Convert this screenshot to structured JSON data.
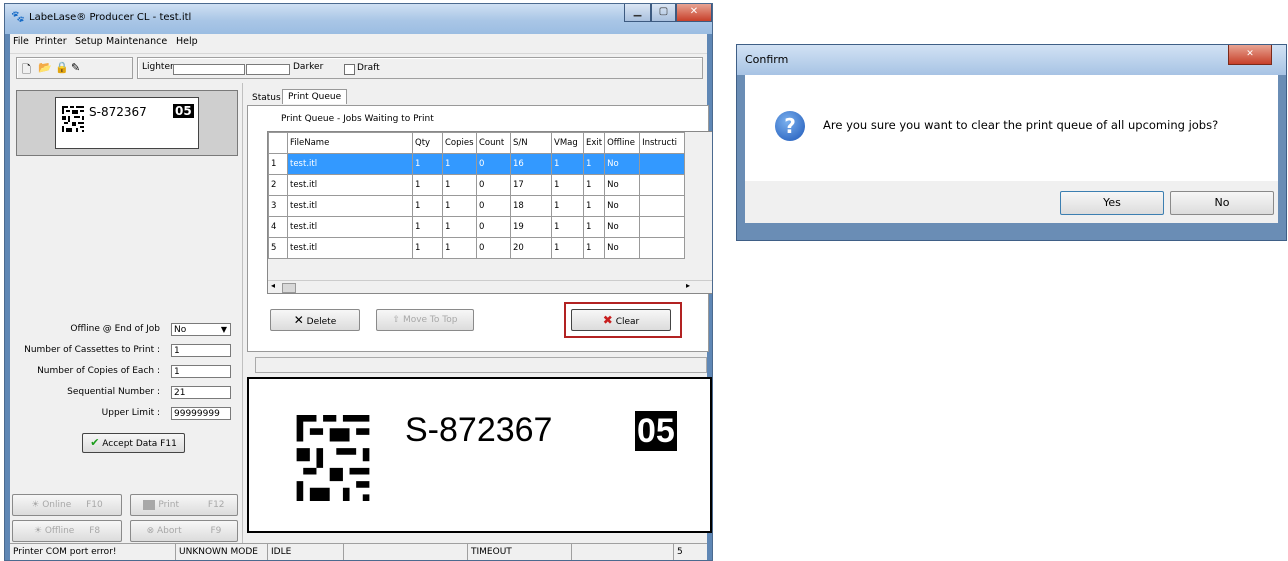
{
  "main_window": {
    "title": "LabeLase® Producer CL - test.itl",
    "menu": [
      "File",
      "Printer",
      "Setup",
      "Maintenance",
      "Help"
    ],
    "toolbar": {
      "lighter_label": "Lighter",
      "darker_label": "Darker",
      "draft_label": "Draft"
    },
    "preview_small": {
      "serial": "S-872367",
      "code": "05"
    },
    "form": {
      "offline_label": "Offline @ End of Job",
      "offline_value": "No",
      "cassettes_label": "Number of Cassettes to Print :",
      "cassettes_value": "1",
      "copies_label": "Number of Copies of Each :",
      "copies_value": "1",
      "seq_label": "Sequential Number :",
      "seq_value": "21",
      "upper_label": "Upper Limit :",
      "upper_value": "99999999",
      "accept_label": "Accept Data  F11"
    },
    "controls": {
      "online_label": "Online",
      "online_key": "F10",
      "print_label": "Print",
      "print_key": "F12",
      "offline_label": "Offline",
      "offline_key": "F8",
      "abort_label": "Abort",
      "abort_key": "F9"
    },
    "tabs": [
      "Status",
      "Print Queue"
    ],
    "queue": {
      "heading": "Print Queue - Jobs Waiting to Print",
      "columns": [
        "FileName",
        "Qty",
        "Copies",
        "Count",
        "S/N",
        "VMag",
        "Exit",
        "Offline",
        "Instructi"
      ],
      "rows": [
        {
          "n": "1",
          "file": "test.itl",
          "qty": "1",
          "copies": "1",
          "count": "0",
          "sn": "16",
          "vmag": "1",
          "exit": "1",
          "offline": "No"
        },
        {
          "n": "2",
          "file": "test.itl",
          "qty": "1",
          "copies": "1",
          "count": "0",
          "sn": "17",
          "vmag": "1",
          "exit": "1",
          "offline": "No"
        },
        {
          "n": "3",
          "file": "test.itl",
          "qty": "1",
          "copies": "1",
          "count": "0",
          "sn": "18",
          "vmag": "1",
          "exit": "1",
          "offline": "No"
        },
        {
          "n": "4",
          "file": "test.itl",
          "qty": "1",
          "copies": "1",
          "count": "0",
          "sn": "19",
          "vmag": "1",
          "exit": "1",
          "offline": "No"
        },
        {
          "n": "5",
          "file": "test.itl",
          "qty": "1",
          "copies": "1",
          "count": "0",
          "sn": "20",
          "vmag": "1",
          "exit": "1",
          "offline": "No"
        }
      ],
      "delete_label": "Delete",
      "movetop_label": "Move To Top",
      "clear_label": "Clear"
    },
    "preview_large": {
      "serial": "S-872367",
      "code": "05"
    },
    "status": {
      "msg": "Printer COM port error!",
      "mode": "UNKNOWN MODE",
      "state": "IDLE",
      "timeout": "TIMEOUT",
      "num": "5"
    }
  },
  "confirm_dialog": {
    "title": "Confirm",
    "message": "Are you sure you want to clear the print queue of all upcoming jobs?",
    "yes_label": "Yes",
    "no_label": "No",
    "icon": "question-icon"
  },
  "colors": {
    "selection": "#3399ff",
    "highlight_border": "#b22222"
  }
}
